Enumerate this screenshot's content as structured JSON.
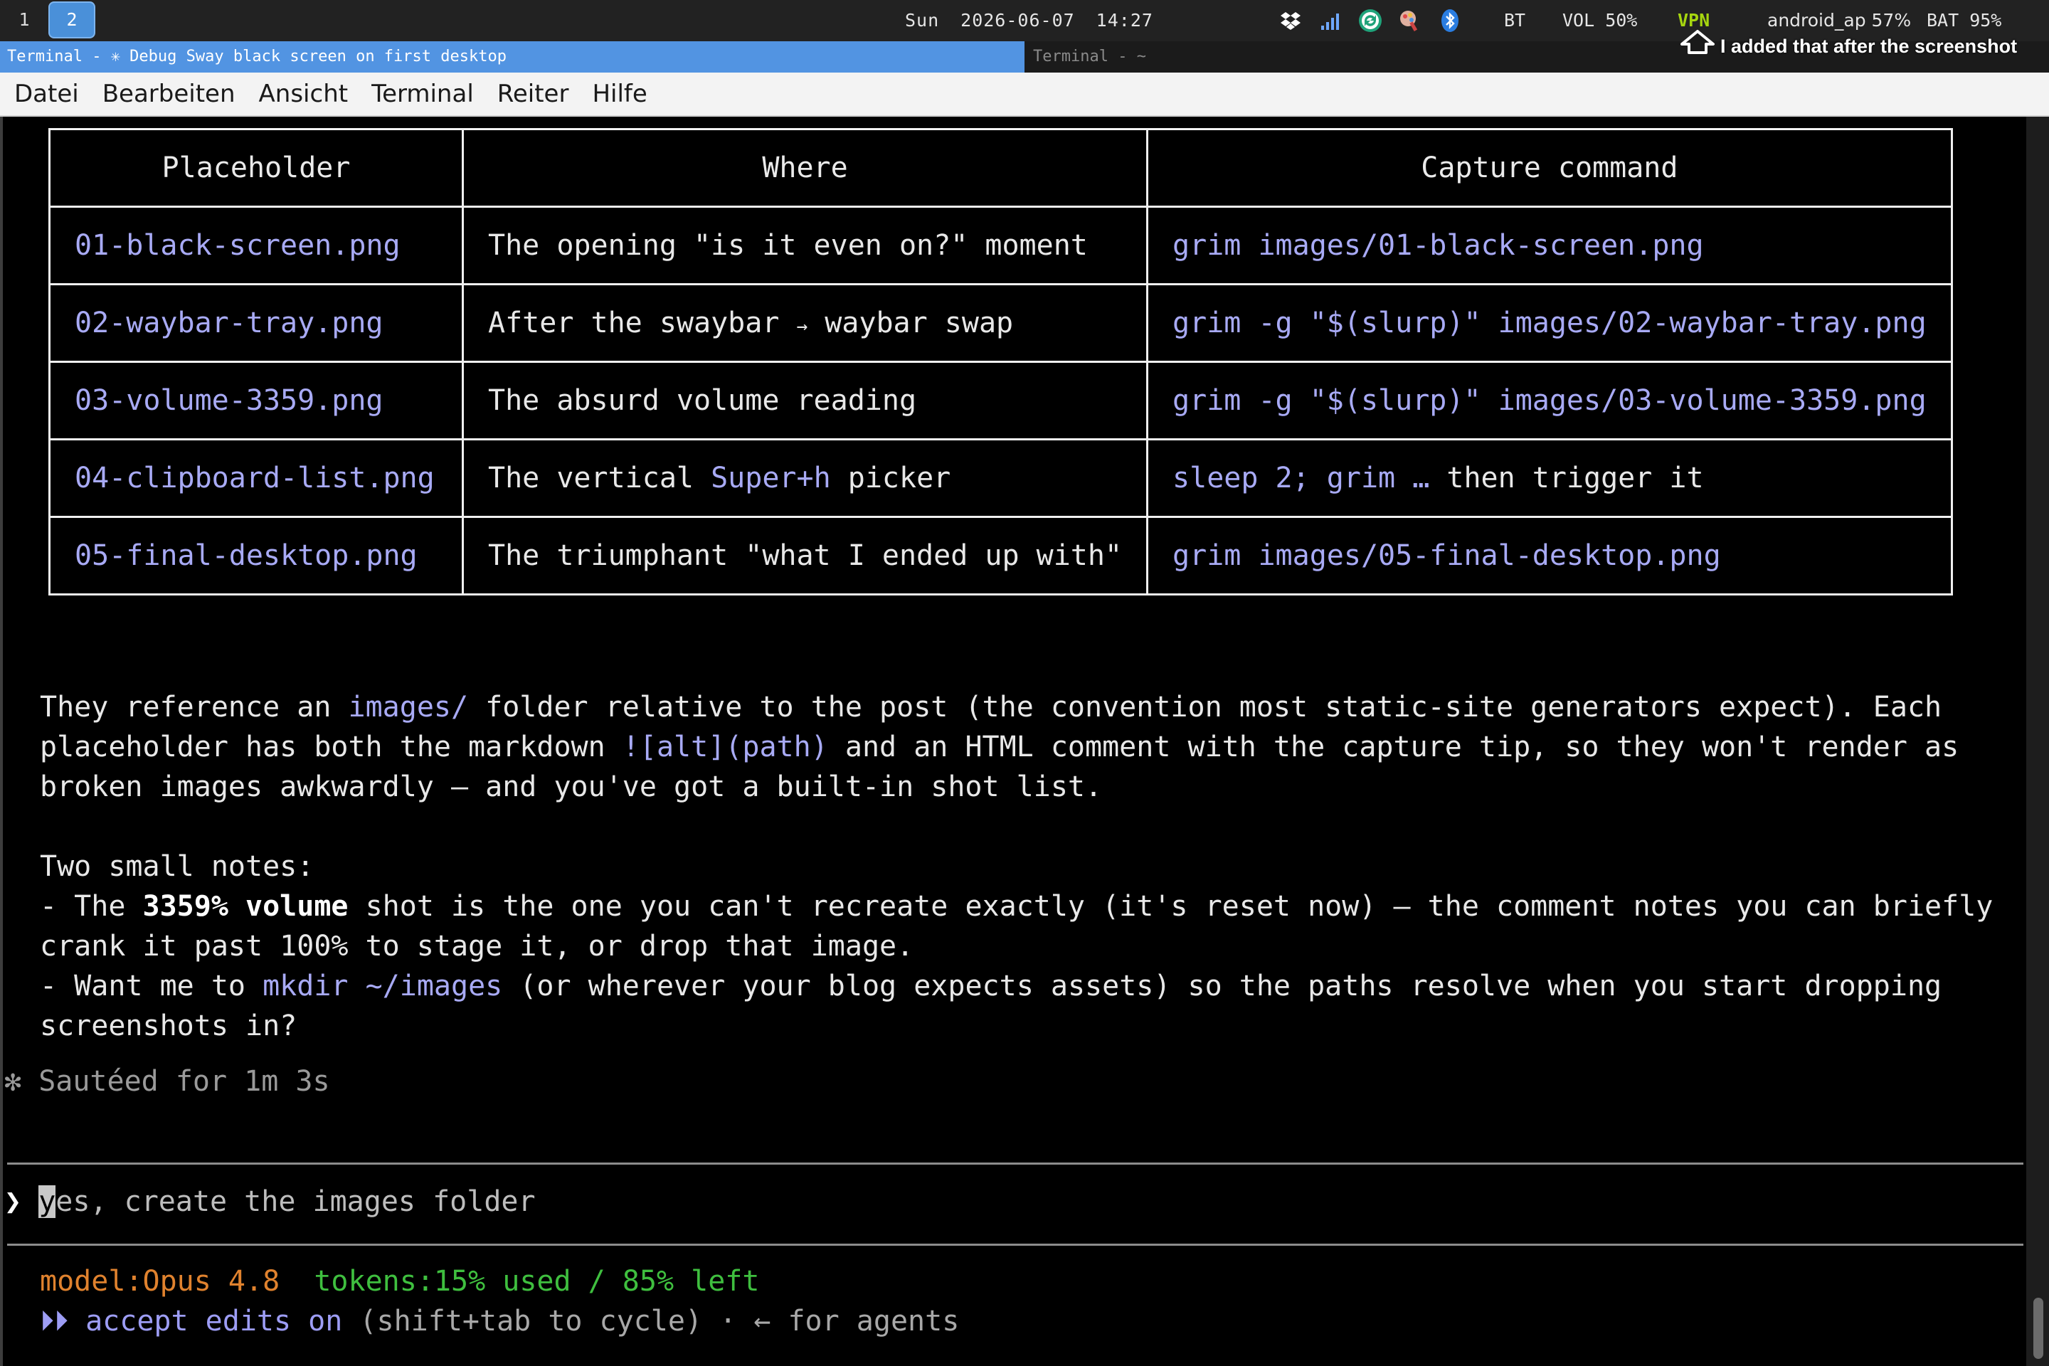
{
  "bar": {
    "workspaces": [
      {
        "label": "1",
        "active": false
      },
      {
        "label": "2",
        "active": true
      }
    ],
    "clock": {
      "day": "Sun",
      "date": "2026-06-07",
      "time": "14:27"
    },
    "tray_icons": [
      "dropbox-icon",
      "signal-bars-icon",
      "sync-icon",
      "color-picker-icon",
      "bluetooth-icon"
    ],
    "bt": "BT",
    "volume": "VOL 50%",
    "vpn": "VPN",
    "wifi": "android_ap 57%",
    "battery": "BAT 95%",
    "vpn_color": "#a6d60f",
    "accent_color": "#5294e2"
  },
  "annotation": {
    "text": "I added that after the screenshot"
  },
  "window": {
    "active_tab": "Terminal - ✳ Debug Sway black screen on first desktop",
    "inactive_tab": "Terminal - ~"
  },
  "menu": {
    "items": [
      "Datei",
      "Bearbeiten",
      "Ansicht",
      "Terminal",
      "Reiter",
      "Hilfe"
    ]
  },
  "table": {
    "headers": [
      "Placeholder",
      "Where",
      "Capture command"
    ],
    "rows": [
      {
        "file": "01-black-screen.png",
        "where": "The opening \"is it even on?\" moment",
        "cmd": "grim images/01-black-screen.png"
      },
      {
        "file": "02-waybar-tray.png",
        "where_pre": "After the swaybar ",
        "where_arrow": "→",
        "where_post": " waybar swap",
        "cmd": "grim -g \"$(slurp)\" images/02-waybar-tray.png"
      },
      {
        "file": "03-volume-3359.png",
        "where": "The absurd volume reading",
        "cmd": "grim -g \"$(slurp)\" images/03-volume-3359.png"
      },
      {
        "file": "04-clipboard-list.png",
        "where_pre": "The vertical ",
        "where_code": "Super+h",
        "where_post": " picker",
        "cmd_code": "sleep 2; grim …",
        "cmd_post": " then trigger it"
      },
      {
        "file": "05-final-desktop.png",
        "where": "The triumphant \"what I ended up with\"",
        "cmd": "grim images/05-final-desktop.png"
      }
    ]
  },
  "body": {
    "p1_a": "They reference an ",
    "p1_code": "images/",
    "p1_b": " folder relative to the post (the convention most static-site generators expect). Each",
    "p2_a": "placeholder has both the markdown ",
    "p2_code": "![alt](path)",
    "p2_b": " and an HTML comment with the capture tip, so they won't render as",
    "p3": "broken images awkwardly — and you've got a built-in shot list.",
    "notes_title": "Two small notes:",
    "n1_a": "- The ",
    "n1_bold": "3359% volume",
    "n1_b": " shot is the one you can't recreate exactly (it's reset now) — the comment notes you can briefly",
    "n1_c": "crank it past 100% to stage it, or drop that image.",
    "n2_a": "- Want me to ",
    "n2_code": "mkdir ~/images",
    "n2_b": " (or wherever your blog expects assets) so the paths resolve when you start dropping",
    "n2_c": "screenshots in?"
  },
  "spinner": {
    "glyph": "✻",
    "text": "Sautéed for 1m 3s"
  },
  "prompt": {
    "caret": "❯",
    "cursor_char": "y",
    "rest": "es, create the images folder"
  },
  "status": {
    "model": "model:Opus 4.8",
    "tokens": "tokens:15% used / 85% left",
    "mode_glyph": "⏵⏵",
    "mode": "accept edits on",
    "hint": " (shift+tab to cycle) · ← for agents"
  }
}
